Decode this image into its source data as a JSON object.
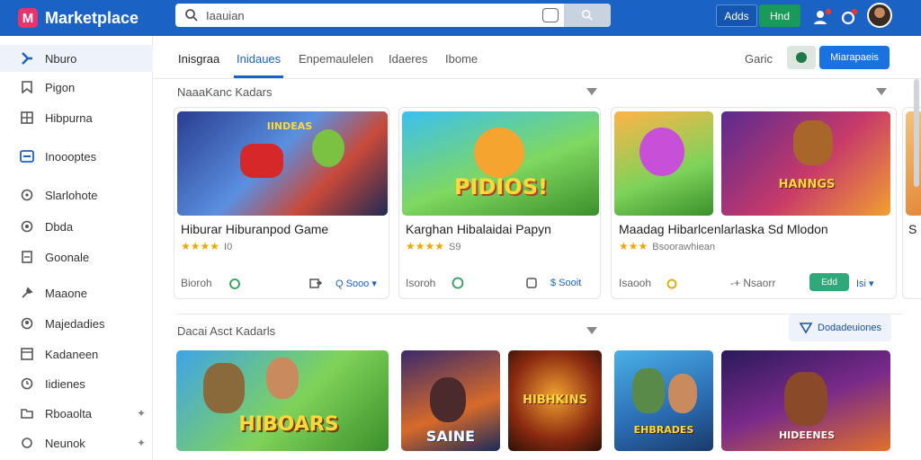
{
  "app": {
    "name": "Marketplace",
    "logo_letter": "M"
  },
  "search": {
    "value": "Iaauian",
    "placeholder": "Search"
  },
  "topbar": {
    "btn1": "Adds",
    "btn2": "Hnd",
    "colors": {
      "bar": "#1a62c4",
      "accent": "#e8336d"
    }
  },
  "sidebar": {
    "items": [
      {
        "label": "Nburo",
        "icon": "puzzle-icon"
      },
      {
        "label": "Pigon",
        "icon": "bookmark-icon"
      },
      {
        "label": "Hibpurna",
        "icon": "grid-icon"
      },
      {
        "label": "Inoooptes",
        "icon": "card-icon"
      },
      {
        "label": "Slarlohote",
        "icon": "clock-icon"
      },
      {
        "label": "Dbda",
        "icon": "circle-icon"
      },
      {
        "label": "Goonale",
        "icon": "doc-icon"
      },
      {
        "label": "Maaone",
        "icon": "wrench-icon"
      },
      {
        "label": "Majedadies",
        "icon": "user-circle-icon"
      },
      {
        "label": "Kadaneen",
        "icon": "box-icon"
      },
      {
        "label": "Iidienes",
        "icon": "clock-icon"
      },
      {
        "label": "Rboaolta",
        "icon": "folder-icon"
      },
      {
        "label": "Neunok",
        "icon": "circle-icon"
      }
    ]
  },
  "tabs": [
    "Inisgraa",
    "Inidaues",
    "Enpemaulelen",
    "Idaeres",
    "Ibome"
  ],
  "toolbar_right": {
    "label": "Garic",
    "primary": "Miarapaeis"
  },
  "sections": [
    {
      "title": "NaaaKanc Kadars"
    },
    {
      "title": "Dacai Asct Kadarls",
      "filter": "Dodadeuiones"
    }
  ],
  "cards_row1": [
    {
      "title": "Hiburar Hiburanpod Game",
      "rating": "★★★★",
      "count": "I0",
      "meta": "Bioroh",
      "link": "Q Sooo ▾",
      "art": "IINDEAS"
    },
    {
      "title": "Karghan Hibalaidai Papyn",
      "rating": "★★★★",
      "count": "S9",
      "meta": "Isoroh",
      "link": "$ Sooit",
      "art": "PIDIOS!"
    },
    {
      "title": "Maadag Hibarlcenlarlaska Sd Mlodon",
      "rating": "★★★",
      "count": "Bsoorawhiean",
      "meta": "Isaooh",
      "link": "-+ Nsaorr",
      "pill": "Edd",
      "extra": "Isi ▾",
      "art": "HANNGS"
    },
    {
      "title": "S",
      "art": ""
    }
  ],
  "cards_row2": [
    {
      "art": "HIBOARS"
    },
    {
      "art": "SAINE"
    },
    {
      "art": "HIBHKINS"
    },
    {
      "art": "EHBRADES"
    },
    {
      "art": "HIDEENES"
    }
  ]
}
